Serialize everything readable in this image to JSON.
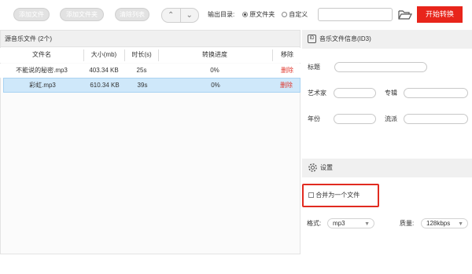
{
  "toolbar": {
    "add_file": "添加文件",
    "add_folder": "添加文件夹",
    "clear_list": "清除列表",
    "move_up_icon": "chevron-up",
    "move_down_icon": "chevron-down",
    "output_label": "输出目录:",
    "option_source": "原文件夹",
    "option_custom": "自定义",
    "path_value": "",
    "start_button": "开始转换",
    "accent": "#e8251b"
  },
  "file_list": {
    "title": "源音乐文件 (2个)",
    "columns": [
      "文件名",
      "大小(mb)",
      "时长(s)",
      "转换进度",
      "移除"
    ],
    "rows": [
      {
        "name": "不能说的秘密.mp3",
        "size": "403.34 KB",
        "duration": "25s",
        "progress": "0%",
        "remove": "删除",
        "selected": false
      },
      {
        "name": "彩虹.mp3",
        "size": "610.34 KB",
        "duration": "39s",
        "progress": "0%",
        "remove": "删除",
        "selected": true
      }
    ]
  },
  "id3": {
    "header": "音乐文件信息(ID3)",
    "icon": "id-icon",
    "title_label": "标题",
    "artist_label": "艺术家",
    "album_label": "专辑",
    "year_label": "年份",
    "genre_label": "流派"
  },
  "settings": {
    "header": "设置",
    "merge_label": "合并为一个文件",
    "format_label": "格式:",
    "format_value": "mp3",
    "quality_label": "质量:",
    "quality_value": "128kbps"
  }
}
